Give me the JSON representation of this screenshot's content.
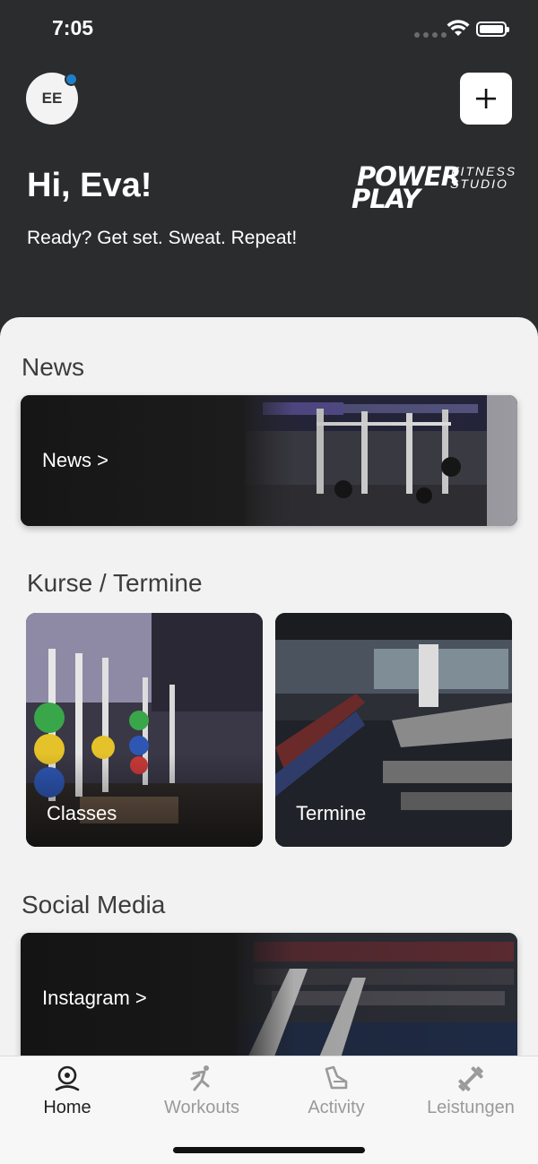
{
  "status_bar": {
    "time": "7:05"
  },
  "header": {
    "avatar_initials": "EE",
    "greeting": "Hi, Eva!",
    "tagline": "Ready? Get set. Sweat. Repeat!",
    "logo": {
      "line1": "POWER",
      "line2": "PLAY",
      "sub1": "FITNESS",
      "sub2": "STUDIO"
    }
  },
  "sections": {
    "news": {
      "title": "News",
      "banner_label": "News >"
    },
    "courses": {
      "title": "Kurse / Termine",
      "cards": [
        {
          "label": "Classes"
        },
        {
          "label": "Termine"
        }
      ]
    },
    "social": {
      "title": "Social Media",
      "banner_label": "Instagram >"
    }
  },
  "tabbar": {
    "tabs": [
      {
        "label": "Home",
        "icon": "home-pin-icon",
        "active": true
      },
      {
        "label": "Workouts",
        "icon": "runner-icon",
        "active": false
      },
      {
        "label": "Activity",
        "icon": "sneaker-icon",
        "active": false
      },
      {
        "label": "Leistungen",
        "icon": "dumbbell-icon",
        "active": false
      }
    ]
  },
  "colors": {
    "header_bg": "#2b2c2e",
    "notification": "#1e7fc8",
    "active_tab": "#222222",
    "inactive_tab": "#9a9a9a"
  }
}
